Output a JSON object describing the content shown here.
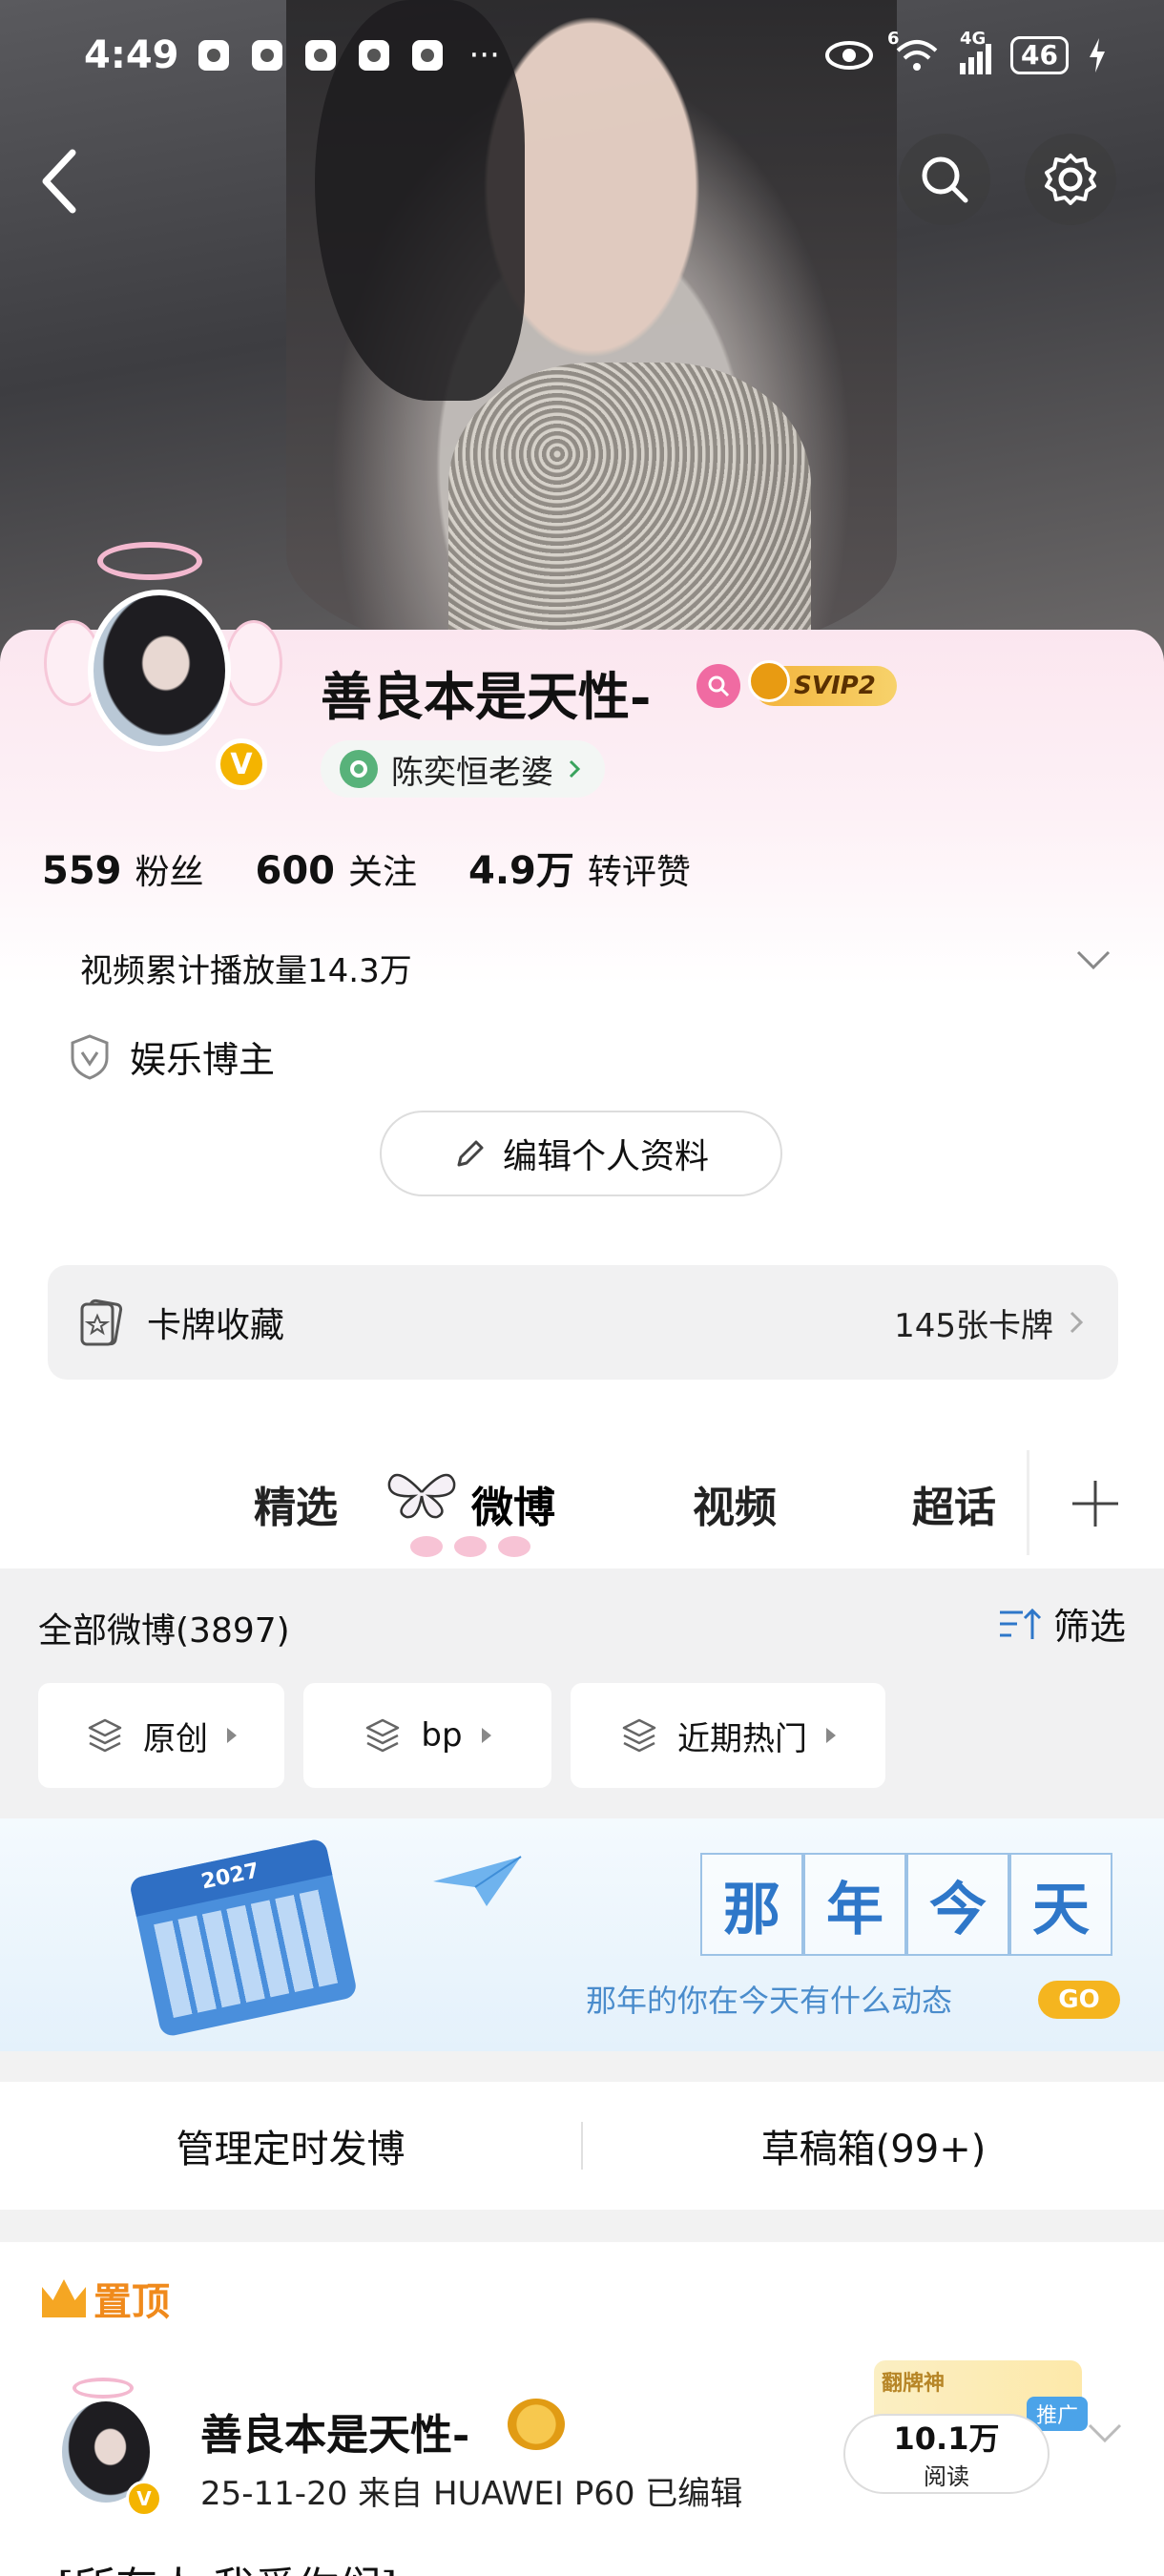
{
  "status_bar": {
    "time": "4:49",
    "dots": "···",
    "network": "4G",
    "wifi_badge": "6",
    "battery": "46"
  },
  "profile": {
    "name": "善良本是天性-",
    "vip_label": "SVIP2",
    "verified_badge": "V",
    "tag_label": "陈奕恒老婆",
    "stats": [
      {
        "value": "559",
        "label": "粉丝"
      },
      {
        "value": "600",
        "label": "关注"
      },
      {
        "value": "4.9万",
        "label": "转评赞"
      }
    ],
    "video_plays": "视频累计播放量14.3万",
    "role": "娱乐博主",
    "edit_label": "编辑个人资料"
  },
  "card_collection": {
    "label": "卡牌收藏",
    "count": "145张卡牌"
  },
  "tabs": [
    "精选",
    "微博",
    "视频",
    "超话"
  ],
  "active_tab": "微博",
  "feed_filter": {
    "all_label": "全部微博(3897)",
    "filter_label": "筛选",
    "chips": [
      "原创",
      "bp",
      "近期热门"
    ]
  },
  "banner": {
    "calendar_year": "2027",
    "title_chars": [
      "那",
      "年",
      "今",
      "天"
    ],
    "subtitle": "那年的你在今天有什么动态",
    "go_label": "GO"
  },
  "manage": {
    "scheduled": "管理定时发博",
    "drafts": "草稿箱(99+)"
  },
  "post": {
    "pinned_label": "置顶",
    "author": "善良本是天性-",
    "meta": "25-11-20  来自 HUAWEI P60  已编辑",
    "stamp_text": "翻牌神",
    "promo_label": "推广",
    "reads_value": "10.1万",
    "reads_label": "阅读",
    "text_preview": "[所有人 我爱你们]"
  },
  "colors": {
    "accent_orange": "#f08a1c",
    "vip_gold": "#f3b33a",
    "link_blue": "#2e77c9",
    "pink": "#f06ba2"
  }
}
